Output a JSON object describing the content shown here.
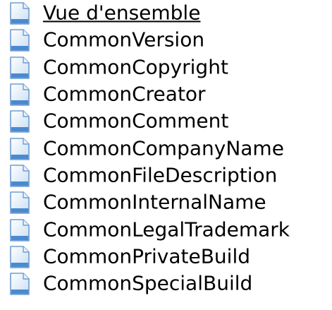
{
  "topics": [
    {
      "label": "Vue d'ensemble",
      "icon": "help-topic-page-icon"
    },
    {
      "label": "CommonVersion",
      "icon": "help-topic-page-icon"
    },
    {
      "label": "CommonCopyright",
      "icon": "help-topic-page-icon"
    },
    {
      "label": "CommonCreator",
      "icon": "help-topic-page-icon"
    },
    {
      "label": "CommonComment",
      "icon": "help-topic-page-icon"
    },
    {
      "label": "CommonCompanyName",
      "icon": "help-topic-page-icon"
    },
    {
      "label": "CommonFileDescription",
      "icon": "help-topic-page-icon"
    },
    {
      "label": "CommonInternalName",
      "icon": "help-topic-page-icon"
    },
    {
      "label": "CommonLegalTrademark",
      "icon": "help-topic-page-icon"
    },
    {
      "label": "CommonPrivateBuild",
      "icon": "help-topic-page-icon"
    },
    {
      "label": "CommonSpecialBuild",
      "icon": "help-topic-page-icon"
    }
  ],
  "colors": {
    "icon_fill_light": "#ffffff",
    "icon_fill_blue": "#c9def4",
    "icon_border": "#6f9dcf",
    "icon_band": "#4a8ad0",
    "text": "#000000"
  }
}
